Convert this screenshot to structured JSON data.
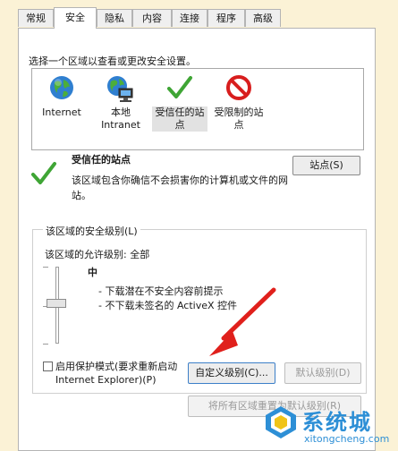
{
  "tabs": [
    "常规",
    "安全",
    "隐私",
    "内容",
    "连接",
    "程序",
    "高级"
  ],
  "instruction": "选择一个区域以查看或更改安全设置。",
  "zones": [
    {
      "icon": "internet-globe-icon",
      "label_line1": "Internet",
      "label_line2": ""
    },
    {
      "icon": "local-intranet-icon",
      "label_line1": "本地",
      "label_line2": "Intranet"
    },
    {
      "icon": "trusted-sites-checkmark-icon",
      "label_line1": "受信任的站",
      "label_line2": "点"
    },
    {
      "icon": "restricted-sites-icon",
      "label_line1": "受限制的站",
      "label_line2": "点"
    }
  ],
  "selected_zone": {
    "title": "受信任的站点",
    "description_line1": "该区域包含你确信不会损害你的计算机或文件的网",
    "description_line2": "站。",
    "sites_button": "站点(S)"
  },
  "security_level": {
    "group_label": "该区域的安全级别(L)",
    "allowed_levels": "该区域的允许级别: 全部",
    "level_name": "中",
    "bullets": [
      "- 下载潜在不安全内容前提示",
      "- 不下载未签名的 ActiveX 控件"
    ],
    "level_fraction": 0.5
  },
  "protected_mode": {
    "label_line1": "启用保护模式(要求重新启动",
    "label_line2": "Internet Explorer)(P)",
    "checked": false
  },
  "buttons": {
    "custom_level": "自定义级别(C)...",
    "default_level": "默认级别(D)",
    "reset_all": "将所有区域重置为默认级别(R)"
  },
  "watermark": {
    "brand": "系统城",
    "url": "xitongcheng.com"
  },
  "colors": {
    "background": "#fbf2d6",
    "arrow": "#e0201c",
    "check": "#3fa535",
    "restricted": "#d81e1e",
    "watermark_blue": "#2d8fd6"
  }
}
